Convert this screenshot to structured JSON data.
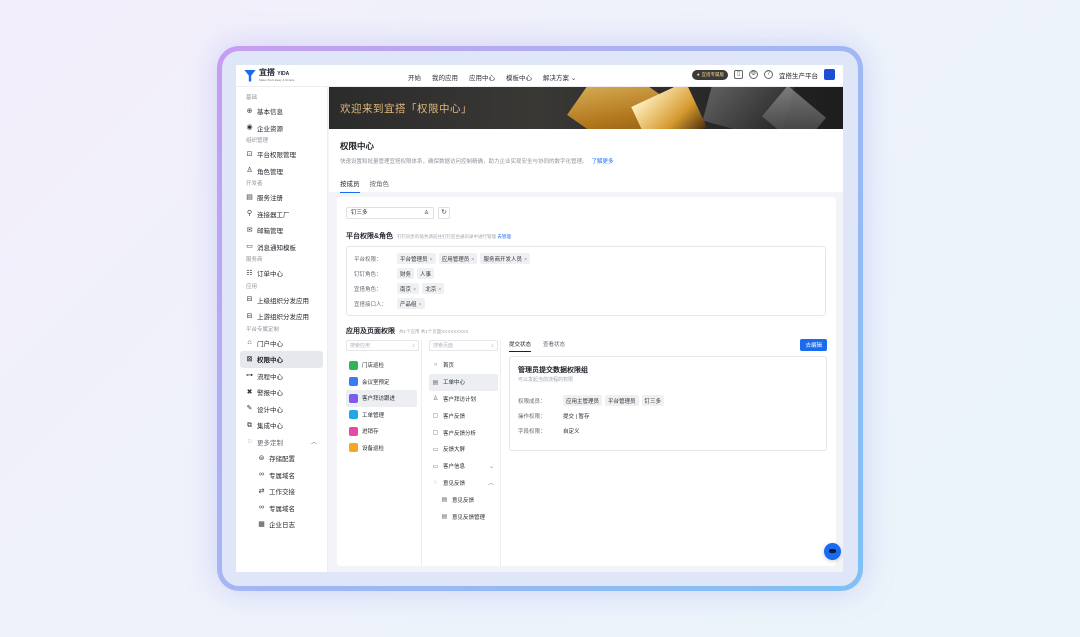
{
  "brand": {
    "name": "宜搭",
    "sub": "YIDA",
    "tagline": "Make Work Easy & Simple"
  },
  "topnav": [
    "开始",
    "我的应用",
    "应用中心",
    "模板中心",
    "解决方案"
  ],
  "topright": {
    "badge": "★ 宜搭专属版",
    "org": "宜搭生产平台"
  },
  "sidebar": {
    "groups": [
      {
        "label": "基础",
        "items": [
          "基本信息",
          "企业资源"
        ]
      },
      {
        "label": "组织管理",
        "items": [
          "平台权限管理",
          "角色管理"
        ]
      },
      {
        "label": "开发者",
        "items": [
          "服务注册",
          "连接器工厂",
          "邮箱管理",
          "消息通知模板"
        ]
      },
      {
        "label": "服务商",
        "items": [
          "订单中心"
        ]
      },
      {
        "label": "应用",
        "items": [
          "上级组织分发应用",
          "上游组织分发应用"
        ]
      },
      {
        "label": "平台专属定制",
        "items": [
          "门户中心",
          "权限中心",
          "流程中心",
          "警报中心",
          "设计中心",
          "集成中心"
        ]
      }
    ],
    "more": "更多定制",
    "sub_items": [
      "存储配置",
      "专属域名",
      "工作交接",
      "专属域名",
      "企业日志"
    ]
  },
  "banner": {
    "title": "欢迎来到宜搭「权限中心」"
  },
  "page": {
    "title": "权限中心",
    "desc": "快速设置和批量管理宜搭权限体系，确保数据访问控制精确，助力企业实现安全与协同的数字化管理。",
    "link": "了解更多",
    "tabs": [
      "按成员",
      "按角色"
    ]
  },
  "search": {
    "user": "钉三多"
  },
  "platform": {
    "title": "平台权限&角色",
    "note": "钉钉同步的角色请前往钉钉后台通讯录中进行管理",
    "note_link": "去管理",
    "rows": [
      {
        "label": "平台权限：",
        "chips": [
          "平台管理员",
          "应用管理员",
          "服务商开发人员"
        ],
        "removable": true
      },
      {
        "label": "钉钉角色：",
        "chips": [
          "财务",
          "人事"
        ],
        "removable": false
      },
      {
        "label": "宜搭角色：",
        "chips": [
          "南京",
          "北京"
        ],
        "removable": true
      },
      {
        "label": "宜搭接口人：",
        "chips": [
          "产品组"
        ],
        "removable": true
      }
    ]
  },
  "apps_section": {
    "title": "应用及页面权限",
    "note": "共1个应用 共1个页面XXXXXXXXX",
    "app_search": "搜索应用",
    "page_search": "搜索页面",
    "apps": [
      {
        "name": "门店巡检",
        "color": "#2fb45a"
      },
      {
        "name": "会议室预定",
        "color": "#3a7bf2"
      },
      {
        "name": "客户拜访跟进",
        "color": "#7b5cf0"
      },
      {
        "name": "工单管理",
        "color": "#22a6e6"
      },
      {
        "name": "进销存",
        "color": "#e84aa2"
      },
      {
        "name": "设备巡检",
        "color": "#f5a623"
      }
    ],
    "pages": [
      {
        "name": "首页",
        "icon": "○"
      },
      {
        "name": "工单中心",
        "icon": "▤"
      },
      {
        "name": "客户拜访计划",
        "icon": "♙"
      },
      {
        "name": "客户反馈",
        "icon": "▢"
      },
      {
        "name": "客户反馈分析",
        "icon": "▢"
      },
      {
        "name": "反馈大屏",
        "icon": "▭"
      },
      {
        "name": "客户信息",
        "icon": "▭"
      },
      {
        "name": "意见反馈",
        "icon": "◌"
      },
      {
        "name": "意见反馈",
        "icon": "▤"
      },
      {
        "name": "意见反馈管理",
        "icon": "▤"
      }
    ]
  },
  "perm": {
    "tabs": [
      "提交状态",
      "查看状态"
    ],
    "edit": "去编辑",
    "card_title": "管理员提交数据权限组",
    "card_sub": "可以发起当前流程的权限",
    "members_label": "权限成员：",
    "members": [
      "应用主管理员",
      "平台管理员",
      "钉三多"
    ],
    "ops_label": "操作权限：",
    "ops": "提交 | 暂存",
    "fields_label": "字段权限：",
    "fields": "自定义"
  }
}
